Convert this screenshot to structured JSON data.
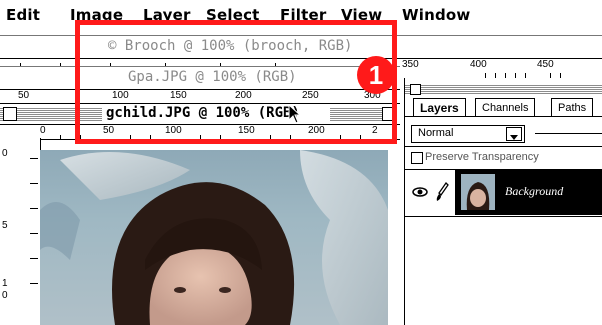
{
  "menubar": {
    "items": [
      "Edit",
      "Image",
      "Layer",
      "Select",
      "Filter",
      "View",
      "Window"
    ]
  },
  "windows": {
    "brooch": {
      "title": "© Brooch @ 100% (brooch, RGB)"
    },
    "gpa": {
      "title": "Gpa.JPG @ 100% (RGB)",
      "ruler_labels": [
        "100",
        "150",
        "200",
        "250",
        "300"
      ]
    },
    "gchild": {
      "title": "gchild.JPG @ 100% (RGB)",
      "top_ruler_labels": [
        "50",
        "100",
        "150",
        "200",
        "250",
        "300"
      ],
      "inner_ruler_labels": [
        "0",
        "50",
        "100",
        "150",
        "200",
        "2"
      ],
      "left_ruler_labels": [
        "0",
        "5",
        "1",
        "0"
      ]
    },
    "behind_right": {
      "ruler_labels": [
        "350",
        "400",
        "450"
      ]
    }
  },
  "layers_panel": {
    "tabs": [
      "Layers",
      "Channels",
      "Paths"
    ],
    "blend_mode": "Normal",
    "preserve_transparency_label": "Preserve Transparency",
    "layer_name": "Background"
  },
  "callout": {
    "number": "1",
    "color": "#ff1a1a"
  },
  "colors": {
    "accent": "#ff1a1a",
    "window_bg": "#ffffff",
    "border": "#000000"
  }
}
